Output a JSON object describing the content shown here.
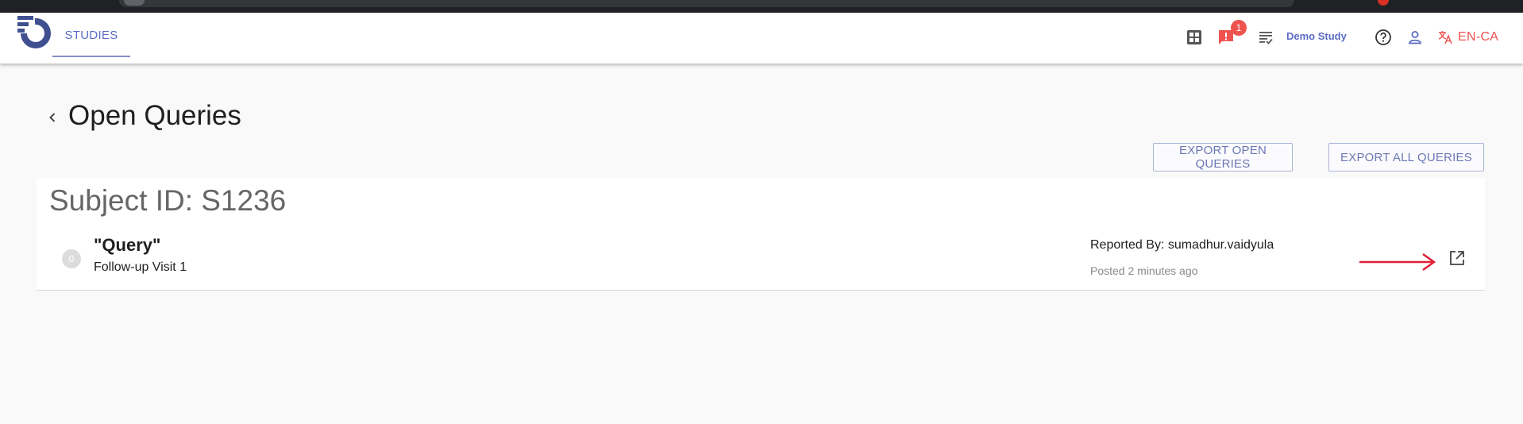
{
  "header": {
    "nav_tab": "STUDIES",
    "notification_count": "1",
    "study_name": "Demo Study",
    "language": "EN-CA"
  },
  "page": {
    "title": "Open Queries"
  },
  "actions": {
    "export_open": "EXPORT OPEN QUERIES",
    "export_all": "EXPORT ALL QUERIES"
  },
  "subject": {
    "label": "Subject ID: S1236",
    "query": {
      "count": "0",
      "title": "\"Query\"",
      "visit": "Follow-up Visit 1",
      "reported_by": "Reported By: sumadhur.vaidyula",
      "posted": "Posted 2 minutes ago"
    }
  },
  "icons": {
    "dashboard": "grid-icon",
    "notifications": "alert-message-icon",
    "tasks": "checklist-icon",
    "help": "help-circle-icon",
    "profile": "person-icon",
    "language": "translate-icon",
    "back": "chevron-left-icon",
    "open": "open-in-new-icon"
  },
  "colors": {
    "accent": "#5b6cc4",
    "alert": "#ef5350",
    "arrow": "#e01e37",
    "logo": "#3f4f8f"
  }
}
